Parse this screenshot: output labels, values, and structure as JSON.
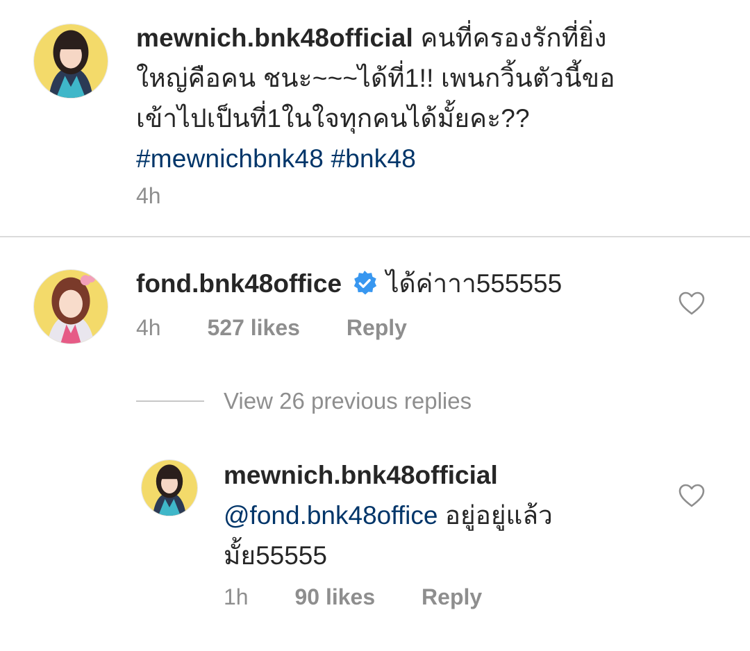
{
  "caption": {
    "username": "mewnich.bnk48official",
    "text_parts": [
      "คนที่ครองรักที่ยิ่ง",
      "ใหญ่คือคน ชนะ~~~ได้ที่1!! เพนกวิ้นตัวนี้ขอ",
      "เข้าไปเป็นที่1ในใจทุกคนได้มั้ยคะ??"
    ],
    "hashtags": "#mewnichbnk48 #bnk48",
    "time": "4h"
  },
  "comment": {
    "username": "fond.bnk48office",
    "verified_icon": "verified-badge-icon",
    "text": "ได้ค่าาา555555",
    "time": "4h",
    "likes": "527 likes",
    "reply_label": "Reply",
    "like_icon": "heart-outline-icon"
  },
  "replies": {
    "view_previous": "View 26 previous replies"
  },
  "reply": {
    "username": "mewnich.bnk48official",
    "mention": "@fond.bnk48office",
    "text_line1": " อยู่อยู่แล้ว",
    "text_line2": "มั้ย55555",
    "time": "1h",
    "likes": "90 likes",
    "reply_label": "Reply",
    "like_icon": "heart-outline-icon"
  },
  "colors": {
    "text": "#262626",
    "secondary": "#8e8e8e",
    "link": "#003569",
    "verified": "#3897f0",
    "divider": "#dbdbdb"
  }
}
